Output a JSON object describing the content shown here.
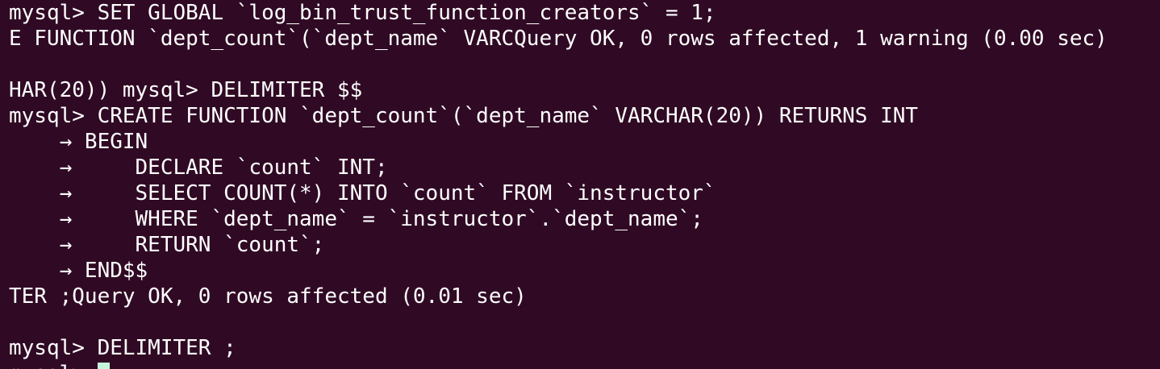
{
  "terminal": {
    "lines": [
      "mysql> SET GLOBAL `log_bin_trust_function_creators` = 1;",
      "E FUNCTION `dept_count`(`dept_name` VARCQuery OK, 0 rows affected, 1 warning (0.00 sec)",
      "",
      "HAR(20)) mysql> DELIMITER $$",
      "mysql> CREATE FUNCTION `dept_count`(`dept_name` VARCHAR(20)) RETURNS INT",
      "    → BEGIN",
      "    →     DECLARE `count` INT;",
      "    →     SELECT COUNT(*) INTO `count` FROM `instructor`",
      "    →     WHERE `dept_name` = `instructor`.`dept_name`;",
      "    →     RETURN `count`;",
      "    → END$$",
      "TER ;Query OK, 0 rows affected (0.01 sec)",
      "",
      "mysql> DELIMITER ;"
    ],
    "prompt": "mysql> "
  },
  "colors": {
    "background": "#300a24",
    "foreground": "#ffffff",
    "cursor": "#c6f3dc"
  }
}
